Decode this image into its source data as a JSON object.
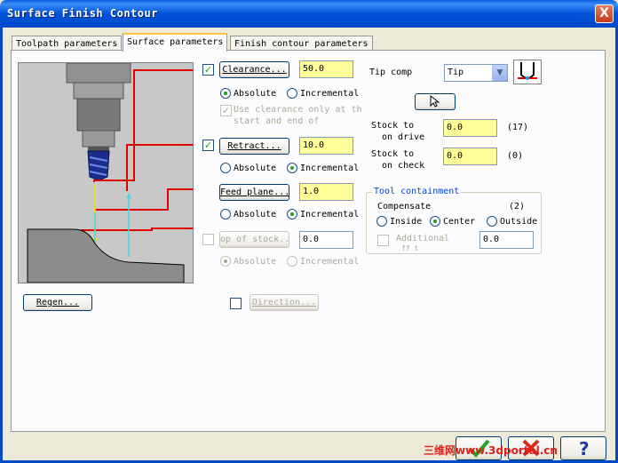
{
  "window": {
    "title": "Surface Finish Contour",
    "close_glyph": "X"
  },
  "tabs": [
    {
      "label": "Toolpath parameters"
    },
    {
      "label": "Surface parameters"
    },
    {
      "label": "Finish contour parameters"
    }
  ],
  "clearance": {
    "label": "Clearance...",
    "value": "50.0",
    "checked": true,
    "absolute": "Absolute",
    "incremental": "Incremental",
    "use_clearance_line1": "Use clearance only at th",
    "use_clearance_line2": "start and end of"
  },
  "retract": {
    "label": "Retract...",
    "value": "10.0",
    "checked": true,
    "absolute": "Absolute",
    "incremental": "Incremental"
  },
  "feed_plane": {
    "label": "Feed plane...",
    "value": "1.0",
    "absolute": "Absolute",
    "incremental": "Incremental"
  },
  "top_of_stock": {
    "label": "op of stock...",
    "value": "0.0",
    "absolute": "Absolute",
    "incremental": "Incremental"
  },
  "tip_comp": {
    "label": "Tip comp",
    "value": "Tip"
  },
  "stock_drive": {
    "line1": "Stock to",
    "line2": "on drive",
    "value": "0.0",
    "count": "(17)"
  },
  "stock_check": {
    "line1": "Stock to",
    "line2": "on check",
    "value": "0.0",
    "count": "(0)"
  },
  "tool_containment": {
    "title": "Tool containment",
    "compensate": "Compensate",
    "count": "(2)",
    "inside": "Inside",
    "center": "Center",
    "outside": "Outside",
    "additional_line1": "Additional",
    "additional_line2": "ff   t",
    "additional_value": "0.0"
  },
  "regen": {
    "label": "Regen..."
  },
  "direction": {
    "label": "Direction..."
  },
  "watermark": "三维网www.3dportal.cn",
  "colors": {
    "accent": "#FFFF99",
    "title_bar": "#0052D9",
    "profile_line": "#E00000",
    "up_arrow": "#44D6E8",
    "down_arrow": "#E8E800"
  }
}
